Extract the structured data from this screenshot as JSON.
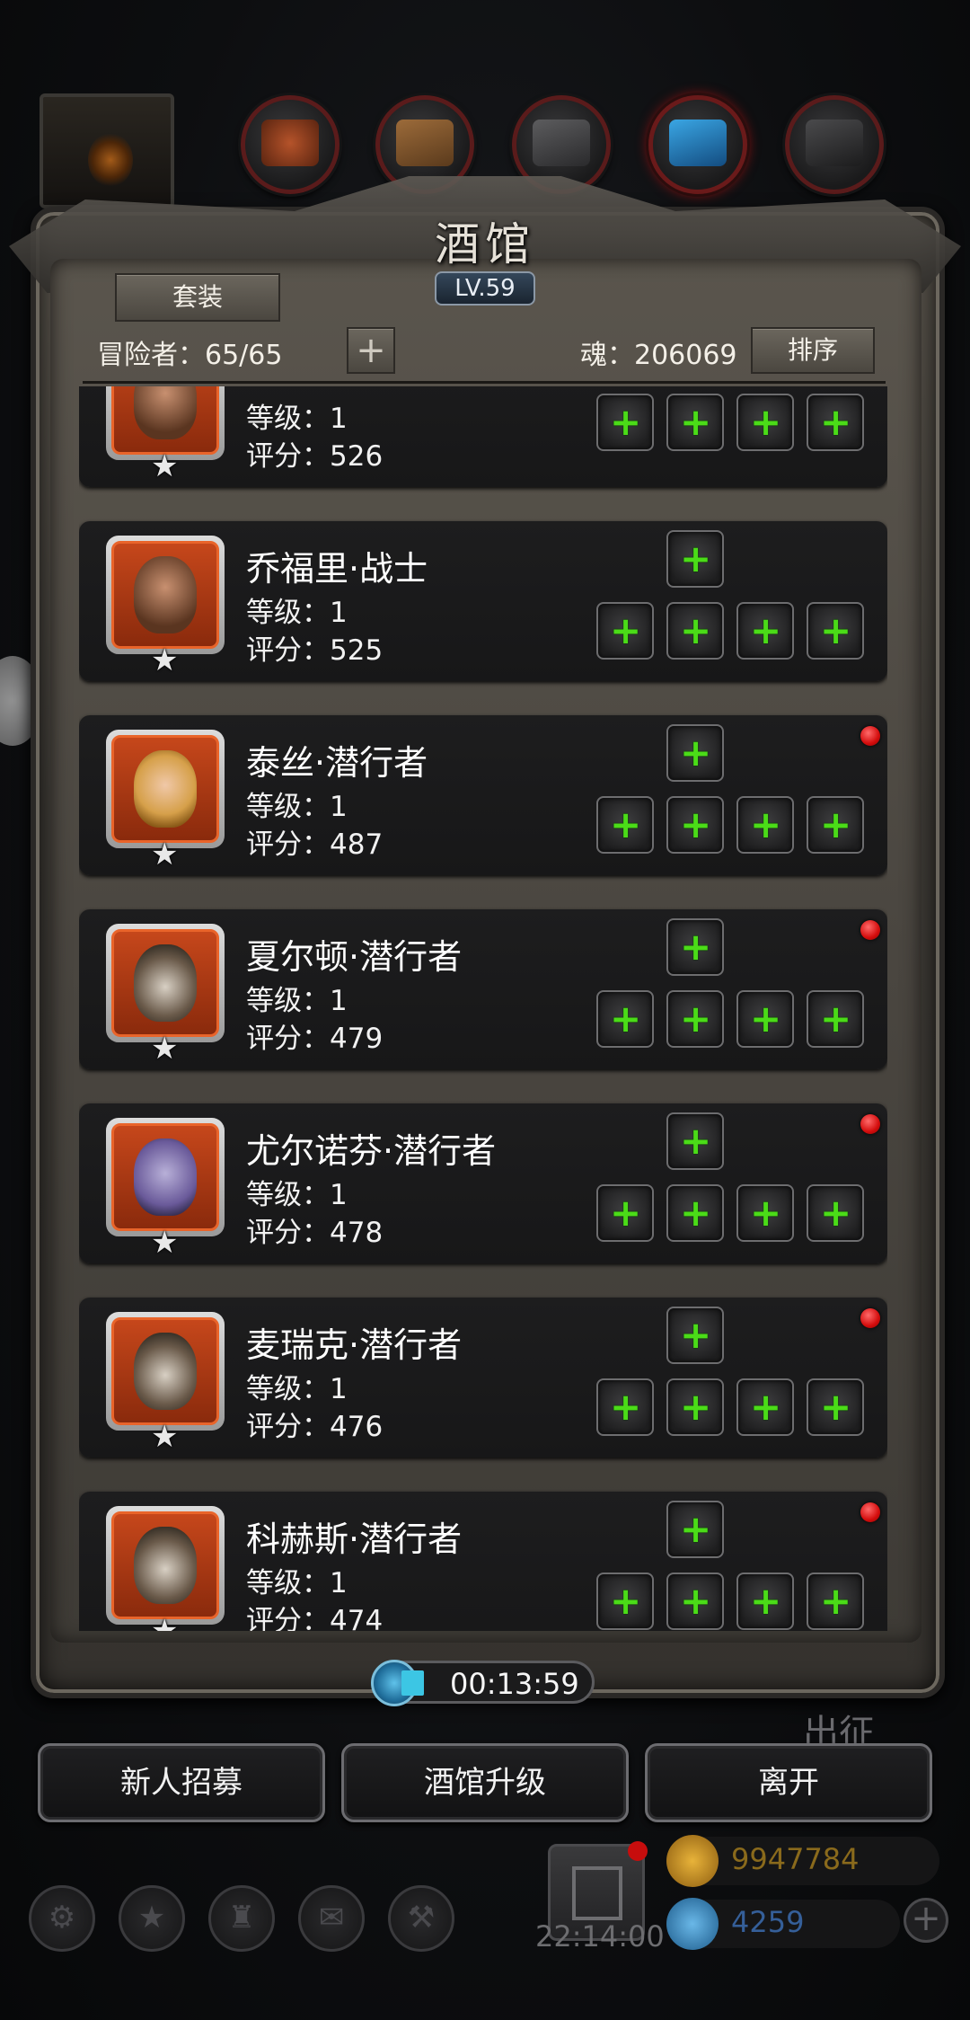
{
  "header": {
    "title": "酒馆",
    "level": "LV.59",
    "top_icons": [
      "portrait-icon",
      "meat-icon",
      "wood-icon",
      "iron-icon",
      "crystal-icon",
      "stone-icon"
    ],
    "set_button": "套装",
    "adventurers_label": "冒险者：65/65",
    "add_symbol": "+",
    "soul_label": "魂：206069",
    "sort_button": "排序"
  },
  "heroes": [
    {
      "name": "",
      "level": "等级：1",
      "score": "评分：526",
      "dot": false,
      "partial": true,
      "portrait": "brown"
    },
    {
      "name": "乔福里·战士",
      "level": "等级：1",
      "score": "评分：525",
      "dot": false,
      "portrait": "brown"
    },
    {
      "name": "泰丝·潜行者",
      "level": "等级：1",
      "score": "评分：487",
      "dot": true,
      "portrait": "blonde"
    },
    {
      "name": "夏尔顿·潜行者",
      "level": "等级：1",
      "score": "评分：479",
      "dot": true,
      "portrait": "hooded"
    },
    {
      "name": "尤尔诺芬·潜行者",
      "level": "等级：1",
      "score": "评分：478",
      "dot": true,
      "portrait": "elf"
    },
    {
      "name": "麦瑞克·潜行者",
      "level": "等级：1",
      "score": "评分：476",
      "dot": true,
      "portrait": "hooded"
    },
    {
      "name": "科赫斯·潜行者",
      "level": "等级：1",
      "score": "评分：474",
      "dot": true,
      "portrait": "hooded"
    }
  ],
  "timer": {
    "value": "00:13:59",
    "progress": 0.12
  },
  "side_label": "出征",
  "buttons": {
    "recruit": "新人招募",
    "upgrade": "酒馆升级",
    "leave": "离开"
  },
  "hud": {
    "clock": "22:14:00",
    "gold": "9947784",
    "gems": "4259",
    "add_symbol": "+"
  },
  "colors": {
    "accent_green": "#4bdc18",
    "alert_red": "#d40d0d",
    "gold_text": "#8a6a1c",
    "gem_text": "#355f99"
  }
}
